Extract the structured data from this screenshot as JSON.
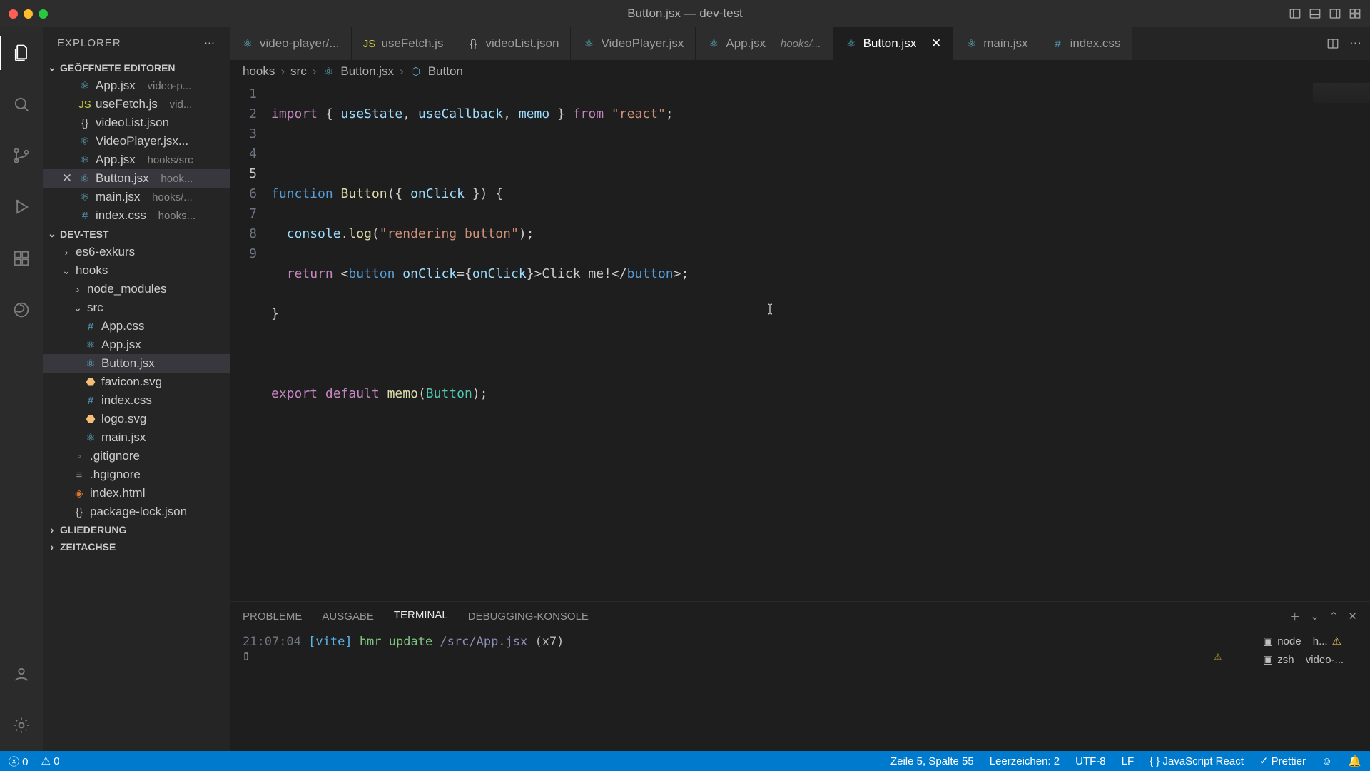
{
  "window": {
    "title": "Button.jsx — dev-test"
  },
  "sidebar": {
    "title": "EXPLORER",
    "open_editors_label": "GEÖFFNETE EDITOREN",
    "workspace_label": "DEV-TEST",
    "outline_label": "GLIEDERUNG",
    "timeline_label": "ZEITACHSE",
    "open_editors": [
      {
        "name": "App.jsx",
        "path": "video-p..."
      },
      {
        "name": "useFetch.js",
        "path": "vid..."
      },
      {
        "name": "videoList.json",
        "path": ""
      },
      {
        "name": "VideoPlayer.jsx...",
        "path": ""
      },
      {
        "name": "App.jsx",
        "path": "hooks/src"
      },
      {
        "name": "Button.jsx",
        "path": "hook..."
      },
      {
        "name": "main.jsx",
        "path": "hooks/..."
      },
      {
        "name": "index.css",
        "path": "hooks..."
      }
    ],
    "tree": {
      "es6": "es6-exkurs",
      "hooks": "hooks",
      "node_modules": "node_modules",
      "src": "src",
      "files": {
        "appcss": "App.css",
        "appjsx": "App.jsx",
        "buttonjsx": "Button.jsx",
        "favicon": "favicon.svg",
        "indexcss": "index.css",
        "logosvg": "logo.svg",
        "mainjsx": "main.jsx",
        "gitignore": ".gitignore",
        "hgignore": ".hgignore",
        "indexhtml": "index.html",
        "pkglock": "package-lock.json"
      }
    }
  },
  "tabs": [
    {
      "name": "video-player/..."
    },
    {
      "name": "useFetch.js"
    },
    {
      "name": "videoList.json"
    },
    {
      "name": "VideoPlayer.jsx"
    },
    {
      "name": "App.jsx",
      "meta": "hooks/..."
    },
    {
      "name": "Button.jsx",
      "active": true
    },
    {
      "name": "main.jsx"
    },
    {
      "name": "index.css"
    }
  ],
  "breadcrumbs": {
    "p1": "hooks",
    "p2": "src",
    "p3": "Button.jsx",
    "p4": "Button"
  },
  "code": {
    "line_numbers": [
      "1",
      "2",
      "3",
      "4",
      "5",
      "6",
      "7",
      "8",
      "9"
    ],
    "current_line": 5,
    "l1a": "import",
    "l1b": " { ",
    "l1c": "useState",
    "l1d": ", ",
    "l1e": "useCallback",
    "l1f": ", ",
    "l1g": "memo",
    "l1h": " } ",
    "l1i": "from",
    "l1j": " ",
    "l1k": "\"react\"",
    "l1l": ";",
    "l3a": "function",
    "l3b": " ",
    "l3c": "Button",
    "l3d": "({ ",
    "l3e": "onClick",
    "l3f": " }) {",
    "l4a": "  ",
    "l4b": "console",
    "l4c": ".",
    "l4d": "log",
    "l4e": "(",
    "l4f": "\"rendering button\"",
    "l4g": ");",
    "l5a": "  ",
    "l5b": "return",
    "l5c": " <",
    "l5d": "button",
    "l5e": " ",
    "l5f": "onClick",
    "l5g": "={",
    "l5h": "onClick",
    "l5i": "}>",
    "l5j": "Click me!",
    "l5k": "</",
    "l5l": "button",
    "l5m": ">;",
    "l6a": "}",
    "l8a": "export",
    "l8b": " ",
    "l8c": "default",
    "l8d": " ",
    "l8e": "memo",
    "l8f": "(",
    "l8g": "Button",
    "l8h": ");"
  },
  "panel": {
    "tabs": {
      "problems": "PROBLEME",
      "output": "AUSGABE",
      "terminal": "TERMINAL",
      "debug": "DEBUGGING-KONSOLE"
    },
    "terminal": {
      "time": "21:07:04",
      "vite": "[vite]",
      "hmr": "hmr update",
      "path": "/src/App.jsx",
      "count": "(x7)"
    },
    "side": {
      "node": "node",
      "node_meta": "h...",
      "zsh": "zsh",
      "zsh_meta": "video-..."
    }
  },
  "status": {
    "errors": "0",
    "warnings": "0",
    "cursor": "Zeile 5, Spalte 55",
    "spaces": "Leerzeichen: 2",
    "encoding": "UTF-8",
    "eol": "LF",
    "lang": "JavaScript React",
    "prettier": "Prettier"
  }
}
